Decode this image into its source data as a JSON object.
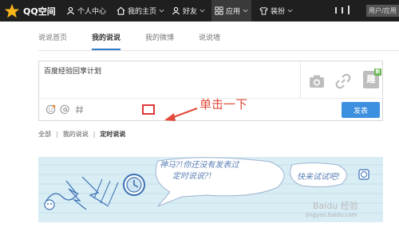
{
  "topbar": {
    "brand": "QQ空间",
    "nav": [
      {
        "label": "个人中心",
        "icon": "user-icon"
      },
      {
        "label": "我的主页",
        "icon": "home-icon"
      },
      {
        "label": "好友",
        "icon": "friends-icon"
      },
      {
        "label": "应用",
        "icon": "apps-icon"
      },
      {
        "label": "装扮",
        "icon": "shirt-icon"
      }
    ],
    "user_label": "用户/应用"
  },
  "tabs": [
    "说说首页",
    "我的说说",
    "我的微博",
    "说说墙"
  ],
  "active_tab": "我的说说",
  "composer": {
    "text": "百度经验回享计划",
    "publish_label": "发表",
    "addon_label": "趣",
    "addon_badge": "新",
    "tools": [
      "camera-icon",
      "link-icon"
    ],
    "bottom_icons": [
      "emoji-icon",
      "at-icon",
      "hashtag-icon"
    ]
  },
  "annotation": {
    "text": "单击一下",
    "color": "#e24a3a"
  },
  "filters": {
    "all": "全部",
    "mine": "我的说说",
    "scheduled": "定时说说",
    "sep": "|"
  },
  "empty_state": {
    "line1": "神马?!你还没有发表过",
    "line2": "定时说说?!",
    "cta": "快来试试吧!"
  },
  "watermark": {
    "main": "Baidu 经验",
    "sub": "jingyan.baidu.com"
  },
  "colors": {
    "topbar": "#1f1f1f",
    "accent": "#3d8fe0",
    "empty_bg": "#d9edf5"
  }
}
